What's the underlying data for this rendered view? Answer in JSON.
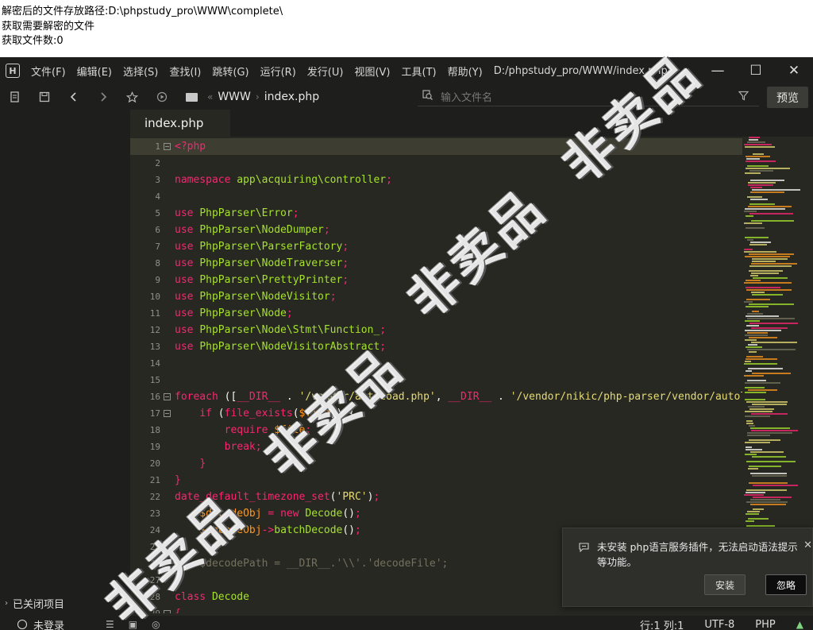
{
  "console": {
    "line1": "解密后的文件存放路径:D:\\phpstudy_pro\\WWW\\complete\\",
    "line2": "获取需要解密的文件",
    "line3": "获取文件数:0"
  },
  "app_icon": "H",
  "menu": [
    "文件(F)",
    "编辑(E)",
    "选择(S)",
    "查找(I)",
    "跳转(G)",
    "运行(R)",
    "发行(U)",
    "视图(V)",
    "工具(T)",
    "帮助(Y)"
  ],
  "window_title": "D:/phpstudy_pro/WWW/index.php...",
  "window_controls": {
    "minimize": "—",
    "maximize": "☐",
    "close": "✕"
  },
  "breadcrumb": {
    "root": "WWW",
    "file": "index.php"
  },
  "search": {
    "placeholder": "输入文件名"
  },
  "preview_label": "预览",
  "sidebar": {
    "closed_items_label": "已关闭项目"
  },
  "tab": {
    "label": "index.php"
  },
  "code_lines": [
    {
      "n": "1",
      "fold": true,
      "tokens": [
        [
          "kw",
          "<?php"
        ]
      ]
    },
    {
      "n": "2",
      "tokens": []
    },
    {
      "n": "3",
      "tokens": [
        [
          "kw",
          "namespace "
        ],
        [
          "cls",
          "app\\acquiring\\controller"
        ],
        [
          "kw",
          ";"
        ]
      ]
    },
    {
      "n": "4",
      "tokens": []
    },
    {
      "n": "5",
      "tokens": [
        [
          "kw",
          "use "
        ],
        [
          "cls",
          "PhpParser\\Error"
        ],
        [
          "kw",
          ";"
        ]
      ]
    },
    {
      "n": "6",
      "tokens": [
        [
          "kw",
          "use "
        ],
        [
          "cls",
          "PhpParser\\NodeDumper"
        ],
        [
          "kw",
          ";"
        ]
      ]
    },
    {
      "n": "7",
      "tokens": [
        [
          "kw",
          "use "
        ],
        [
          "cls",
          "PhpParser\\ParserFactory"
        ],
        [
          "kw",
          ";"
        ]
      ]
    },
    {
      "n": "8",
      "tokens": [
        [
          "kw",
          "use "
        ],
        [
          "cls",
          "PhpParser\\NodeTraverser"
        ],
        [
          "kw",
          ";"
        ]
      ]
    },
    {
      "n": "9",
      "tokens": [
        [
          "kw",
          "use "
        ],
        [
          "cls",
          "PhpParser\\PrettyPrinter"
        ],
        [
          "kw",
          ";"
        ]
      ]
    },
    {
      "n": "10",
      "tokens": [
        [
          "kw",
          "use "
        ],
        [
          "cls",
          "PhpParser\\NodeVisitor"
        ],
        [
          "kw",
          ";"
        ]
      ]
    },
    {
      "n": "11",
      "tokens": [
        [
          "kw",
          "use "
        ],
        [
          "cls",
          "PhpParser\\Node"
        ],
        [
          "kw",
          ";"
        ]
      ]
    },
    {
      "n": "12",
      "tokens": [
        [
          "kw",
          "use "
        ],
        [
          "cls",
          "PhpParser\\Node\\Stmt\\Function_"
        ],
        [
          "kw",
          ";"
        ]
      ]
    },
    {
      "n": "13",
      "tokens": [
        [
          "kw",
          "use "
        ],
        [
          "cls",
          "PhpParser\\NodeVisitorAbstract"
        ],
        [
          "kw",
          ";"
        ]
      ]
    },
    {
      "n": "14",
      "tokens": []
    },
    {
      "n": "15",
      "tokens": []
    },
    {
      "n": "16",
      "fold": true,
      "tokens": [
        [
          "kw",
          "foreach "
        ],
        [
          "plain",
          "(["
        ],
        [
          "kw",
          "__DIR__"
        ],
        [
          "plain",
          " . "
        ],
        [
          "str",
          "'/vendor/autoload.php'"
        ],
        [
          "plain",
          ", "
        ],
        [
          "kw",
          "__DIR__"
        ],
        [
          "plain",
          " . "
        ],
        [
          "str",
          "'/vendor/nikic/php-parser/vendor/autoload.php'"
        ]
      ]
    },
    {
      "n": "17",
      "fold": true,
      "tokens": [
        [
          "plain",
          "    "
        ],
        [
          "kw",
          "if "
        ],
        [
          "plain",
          "("
        ],
        [
          "kw",
          "file_exists"
        ],
        [
          "plain",
          "("
        ],
        [
          "var",
          "$file"
        ],
        [
          "plain",
          ")) {"
        ]
      ]
    },
    {
      "n": "18",
      "tokens": [
        [
          "plain",
          "        "
        ],
        [
          "kw",
          "require "
        ],
        [
          "var",
          "$file"
        ],
        [
          "kw",
          ";"
        ]
      ]
    },
    {
      "n": "19",
      "tokens": [
        [
          "plain",
          "        "
        ],
        [
          "kw",
          "break"
        ],
        [
          "kw",
          ";"
        ]
      ]
    },
    {
      "n": "20",
      "tokens": [
        [
          "plain",
          "    "
        ],
        [
          "kw",
          "}"
        ]
      ]
    },
    {
      "n": "21",
      "tokens": [
        [
          "kw",
          "}"
        ]
      ]
    },
    {
      "n": "22",
      "tokens": [
        [
          "kw",
          "date_default_timezone_set"
        ],
        [
          "plain",
          "("
        ],
        [
          "str",
          "'PRC'"
        ],
        [
          "plain",
          ")"
        ],
        [
          "kw",
          ";"
        ]
      ]
    },
    {
      "n": "23",
      "tokens": [
        [
          "plain",
          "    "
        ],
        [
          "var",
          "$decodeObj"
        ],
        [
          "kw",
          " = new "
        ],
        [
          "cls",
          "Decode"
        ],
        [
          "plain",
          "()"
        ],
        [
          "kw",
          ";"
        ]
      ]
    },
    {
      "n": "24",
      "tokens": [
        [
          "plain",
          "    "
        ],
        [
          "var",
          "$decodeObj"
        ],
        [
          "kw",
          "->"
        ],
        [
          "cls",
          "batchDecode"
        ],
        [
          "plain",
          "()"
        ],
        [
          "kw",
          ";"
        ]
      ]
    },
    {
      "n": "25",
      "tokens": []
    },
    {
      "n": "26",
      "tokens": [
        [
          "cm",
          "//  $decodePath = __DIR__.'\\\\'.'decodeFile';"
        ]
      ]
    },
    {
      "n": "27",
      "tokens": []
    },
    {
      "n": "28",
      "tokens": [
        [
          "kw",
          "class "
        ],
        [
          "cls",
          "Decode"
        ]
      ]
    },
    {
      "n": "29",
      "fold": true,
      "tokens": [
        [
          "kw",
          "{"
        ]
      ]
    }
  ],
  "notification": {
    "message": "未安装 php语言服务插件，无法启动语法提示等功能。",
    "install_label": "安装",
    "ignore_label": "忽略",
    "close": "✕"
  },
  "status": {
    "login": "未登录",
    "position": "行:1  列:1",
    "encoding": "UTF-8",
    "language": "PHP"
  },
  "watermark": "非卖品",
  "colors": {
    "editor_bg": "#272822",
    "keyword": "#f92672",
    "class": "#a6e22e",
    "string": "#e6db74",
    "variable": "#fd971f",
    "comment": "#75715e"
  }
}
